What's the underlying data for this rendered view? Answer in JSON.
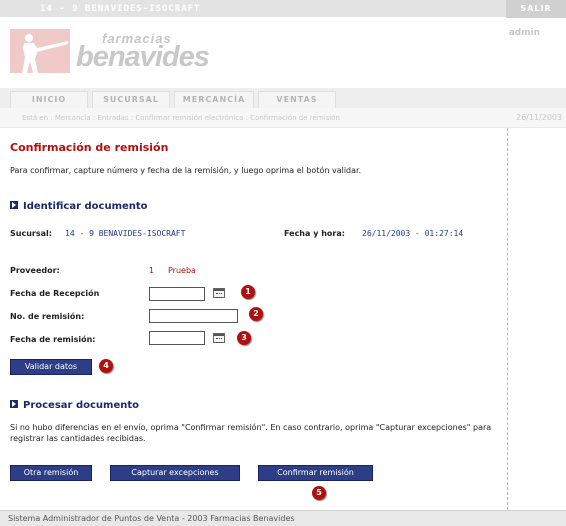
{
  "topbar": {
    "store": "14 - 9   BENAVIDES-ISOCRAFT",
    "logout": "SALIR"
  },
  "header": {
    "logo_small": "farmacias",
    "logo_big": "benavides",
    "user": "admin"
  },
  "nav": {
    "tabs": [
      "INICIO",
      "SUCURSAL",
      "MERCANCÍA",
      "VENTAS"
    ]
  },
  "breadcrumb": {
    "path": "Está en : Mercancía : Entradas : Confirmar remisión electrónica : Confirmación de remisión",
    "date": "26/11/2003"
  },
  "page": {
    "title": "Confirmación de remisión",
    "intro": "Para confirmar, capture número y fecha de la remisión, y luego oprima el botón validar."
  },
  "identify": {
    "heading": "Identificar documento",
    "branch_label": "Sucursal:",
    "branch_value": "14 - 9  BENAVIDES-ISOCRAFT",
    "datetime_label": "Fecha y hora:",
    "datetime_value": "26/11/2003 - 01:27:14"
  },
  "form": {
    "supplier_label": "Proveedor:",
    "supplier_id": "1",
    "supplier_name": "Prueba",
    "reception_date_label": "Fecha de Recepción",
    "reception_date_value": "",
    "remision_no_label": "No. de remisión:",
    "remision_no_value": "",
    "remision_date_label": "Fecha de remisión:",
    "remision_date_value": "",
    "validate_button": "Validar datos"
  },
  "process": {
    "heading": "Procesar documento",
    "text": "Si no hubo diferencias en el envío, oprima \"Confirmar remisión\". En caso contrario, oprima \"Capturar excepciones\" para registrar las cantidades recibidas.",
    "other_button": "Otra remisión",
    "exceptions_button": "Capturar excepciones",
    "confirm_button": "Confirmar remisión"
  },
  "markers": [
    "1",
    "2",
    "3",
    "4",
    "5"
  ],
  "footer": {
    "text": "Sistema Administrador de Puntos de Venta - 2003 Farmacias Benavides"
  },
  "colors": {
    "accent_red": "#b01010",
    "navy": "#1a2a6c",
    "button": "#2d3e87"
  }
}
